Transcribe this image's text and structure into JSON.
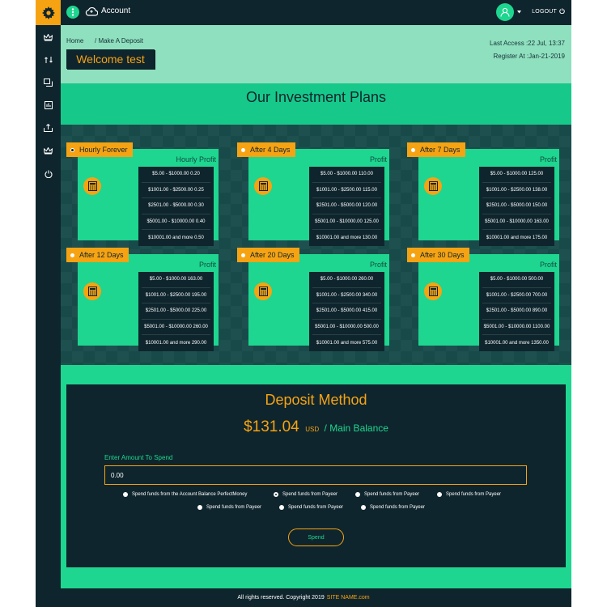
{
  "topbar": {
    "account_label": "Account",
    "logout_label": "LOGOUT"
  },
  "sidebar": {
    "items": [
      {
        "icon": "crown-icon"
      },
      {
        "icon": "transfer-icon"
      },
      {
        "icon": "history-icon"
      },
      {
        "icon": "stats-icon"
      },
      {
        "icon": "withdraw-icon"
      },
      {
        "icon": "crown-icon"
      },
      {
        "icon": "power-icon"
      }
    ]
  },
  "header": {
    "breadcrumb_home": "Home",
    "breadcrumb_sep": "/ Make A Deposit",
    "welcome": "Welcome test",
    "last_access": "Last Access :22 Jul, 13:37",
    "registered": "Register At :Jan-21-2019"
  },
  "plans_title": "Our Investment Plans",
  "plans": [
    {
      "name": "Hourly Forever",
      "profit_label": "Hourly Profit",
      "rates": [
        "$5.00 - $1000.00 0.20",
        "$1001.00 - $2500.00 0.25",
        "$2501.00 - $5000.00 0.30",
        "$5001.00 - $10000.00 0.40",
        "$10001.00 and more 0.50"
      ]
    },
    {
      "name": "After 4 Days",
      "profit_label": "Profit",
      "rates": [
        "$5.00 - $1000.00 110.00",
        "$1001.00 - $2500.00 115.00",
        "$2501.00 - $5000.00 120.00",
        "$5001.00 - $10000.00 125.00",
        "$10001.00 and more 130.00"
      ]
    },
    {
      "name": "After 7 Days",
      "profit_label": "Profit",
      "rates": [
        "$5.00 - $1000.00 125.00",
        "$1001.00 - $2500.00 138.00",
        "$2501.00 - $5000.00 150.00",
        "$5001.00 - $10000.00 163.00",
        "$10001.00 and more 175.00"
      ]
    },
    {
      "name": "After 12 Days",
      "profit_label": "Profit",
      "rates": [
        "$5.00 - $1000.00 163.00",
        "$1001.00 - $2500.00 195.00",
        "$2501.00 - $5000.00 225.00",
        "$5001.00 - $10000.00 260.00",
        "$10001.00 and more 290.00"
      ]
    },
    {
      "name": "After 20 Days",
      "profit_label": "Profit",
      "rates": [
        "$5.00 - $1000.00 260.00",
        "$1001.00 - $2500.00 340.00",
        "$2501.00 - $5000.00 415.00",
        "$5001.00 - $10000.00 500.00",
        "$10001.00 and more 575.00"
      ]
    },
    {
      "name": "After 30 Days",
      "profit_label": "Profit",
      "rates": [
        "$5.00 - $1000.00 500.00",
        "$1001.00 - $2500.00 700.00",
        "$2501.00 - $5000.00 890.00",
        "$5001.00 - $10000.00 1100.00",
        "$10001.00 and more 1350.00"
      ]
    }
  ],
  "deposit": {
    "title": "Deposit Method",
    "balance": "$131.04",
    "currency": "USD",
    "balance_label": "/ Main Balance",
    "amount_label": "Enter Amount To Spend",
    "amount_value": "0.00",
    "options": [
      {
        "label": "Spend funds from the Account Balance PerfectMoney",
        "selected": false
      },
      {
        "label": "Spend funds from Payeer",
        "selected": true
      },
      {
        "label": "Spend funds from Payeer",
        "selected": false
      },
      {
        "label": "Spend funds from Payeer",
        "selected": false
      },
      {
        "label": "Spend funds from Payeer",
        "selected": false
      },
      {
        "label": "Spend funds from Payeer",
        "selected": false
      },
      {
        "label": "Spend funds from Payeer",
        "selected": false
      }
    ],
    "button_label": "Spend"
  },
  "footer": {
    "text": "All rights reserved. Copyright 2019",
    "site": "SITE NAME.com"
  },
  "colors": {
    "accent": "#f6a313",
    "green": "#1ed68f",
    "dark": "#0f252d",
    "panel": "#184a4a"
  }
}
